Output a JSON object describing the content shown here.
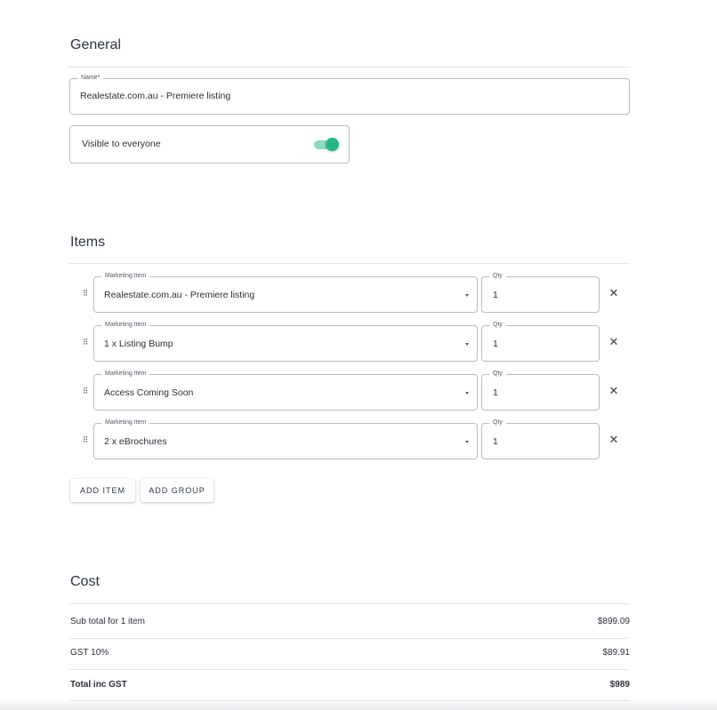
{
  "general": {
    "title": "General",
    "name_field": {
      "label": "Name*",
      "value": "Realestate.com.au - Premiere listing"
    },
    "visibility": {
      "label": "Visible to everyone",
      "enabled": true
    }
  },
  "items": {
    "title": "Items",
    "rows": [
      {
        "item_label": "Marketing Item",
        "item_value": "Realestate.com.au - Premiere listing",
        "qty_label": "Qty",
        "qty_value": "1"
      },
      {
        "item_label": "Marketing Item",
        "item_value": "1 x Listing Bump",
        "qty_label": "Qty",
        "qty_value": "1"
      },
      {
        "item_label": "Marketing Item",
        "item_value": "Access Coming Soon",
        "qty_label": "Qty",
        "qty_value": "1"
      },
      {
        "item_label": "Marketing Item",
        "item_value": "2 x eBrochures",
        "qty_label": "Qty",
        "qty_value": "1"
      }
    ],
    "add_item_label": "ADD ITEM",
    "add_group_label": "ADD GROUP"
  },
  "cost": {
    "title": "Cost",
    "subtotal_label": "Sub total for 1 item",
    "subtotal_value": "$899.09",
    "gst_label": "GST 10%",
    "gst_value": "$89.91",
    "total_label": "Total inc GST",
    "total_value": "$989"
  },
  "colors": {
    "accent": "#21b88a",
    "accent_light": "#8ed8bf",
    "border": "#b8bcc6"
  },
  "icons": {
    "drag": "drag-handle-icon",
    "remove": "close-icon",
    "dropdown": "chevron-down-icon"
  }
}
